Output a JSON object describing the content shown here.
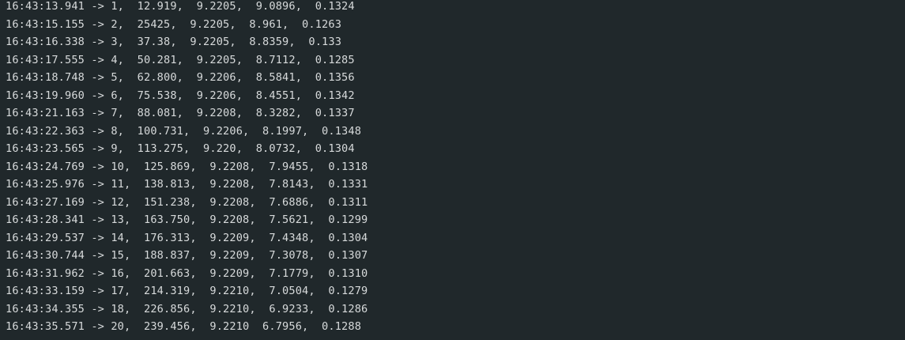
{
  "terminal": {
    "lines": [
      "16:43:13.941 -> 1,  12.919,  9.2205,  9.0896,  0.1324",
      "16:43:15.155 -> 2,  25425,  9.2205,  8.961,  0.1263",
      "16:43:16.338 -> 3,  37.38,  9.2205,  8.8359,  0.133",
      "16:43:17.555 -> 4,  50.281,  9.2205,  8.7112,  0.1285",
      "16:43:18.748 -> 5,  62.800,  9.2206,  8.5841,  0.1356",
      "16:43:19.960 -> 6,  75.538,  9.2206,  8.4551,  0.1342",
      "16:43:21.163 -> 7,  88.081,  9.2208,  8.3282,  0.1337",
      "16:43:22.363 -> 8,  100.731,  9.2206,  8.1997,  0.1348",
      "16:43:23.565 -> 9,  113.275,  9.220,  8.0732,  0.1304",
      "16:43:24.769 -> 10,  125.869,  9.2208,  7.9455,  0.1318",
      "16:43:25.976 -> 11,  138.813,  9.2208,  7.8143,  0.1331",
      "16:43:27.169 -> 12,  151.238,  9.2208,  7.6886,  0.1311",
      "16:43:28.341 -> 13,  163.750,  9.2208,  7.5621,  0.1299",
      "16:43:29.537 -> 14,  176.313,  9.2209,  7.4348,  0.1304",
      "16:43:30.744 -> 15,  188.837,  9.2209,  7.3078,  0.1307",
      "16:43:31.962 -> 16,  201.663,  9.2209,  7.1779,  0.1310",
      "16:43:33.159 -> 17,  214.319,  9.2210,  7.0504,  0.1279",
      "16:43:34.355 -> 18,  226.856,  9.2210,  6.9233,  0.1286",
      "16:43:35.571 -> 20,  239.456,  9.2210  6.7956,  0.1288"
    ]
  },
  "colors": {
    "background": "#20282b",
    "text": "#d7dadb"
  }
}
